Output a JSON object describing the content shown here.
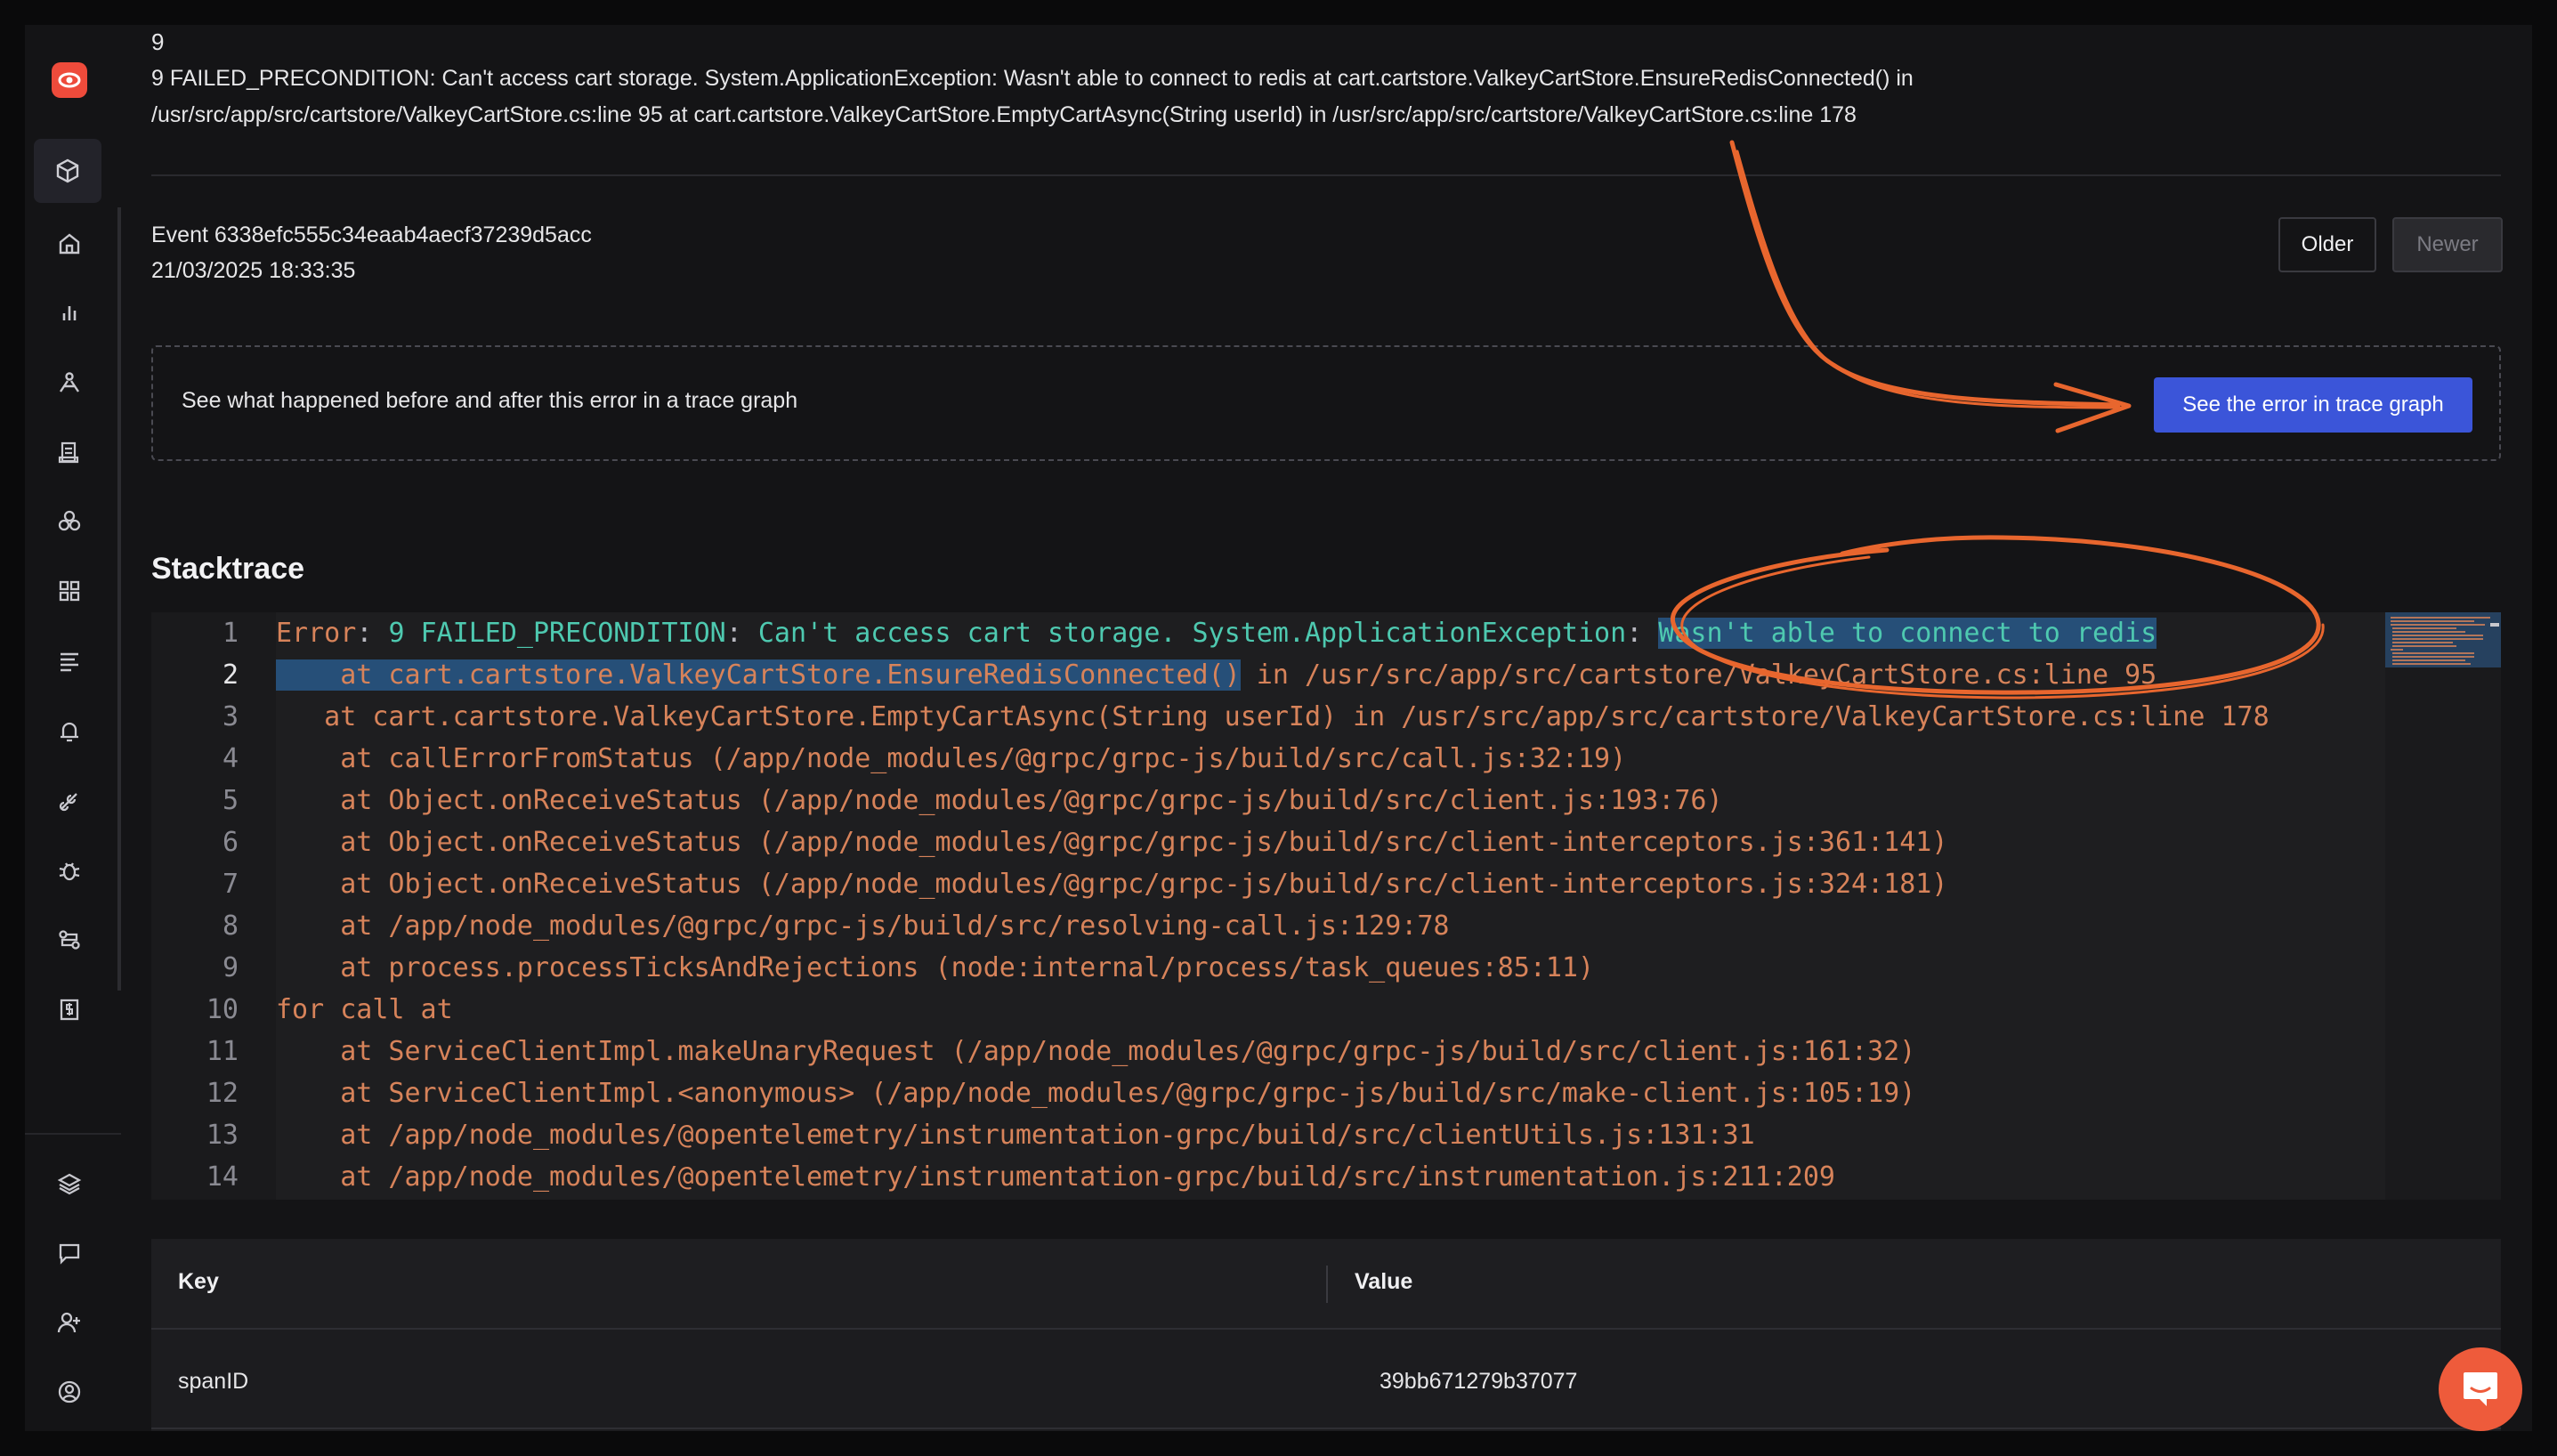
{
  "header": {
    "count": "9",
    "message_line1": "9 FAILED_PRECONDITION: Can't access cart storage. System.ApplicationException: Wasn't able to connect to redis at cart.cartstore.ValkeyCartStore.EnsureRedisConnected() in",
    "message_line2": "/usr/src/app/src/cartstore/ValkeyCartStore.cs:line 95 at cart.cartstore.ValkeyCartStore.EmptyCartAsync(String userId) in /usr/src/app/src/cartstore/ValkeyCartStore.cs:line 178"
  },
  "event": {
    "id": "Event 6338efc555c34eaab4aecf37239d5acc",
    "time": "21/03/2025 18:33:35",
    "older_label": "Older",
    "newer_label": "Newer"
  },
  "trace": {
    "text": "See what happened before and after this error in a trace graph",
    "button_label": "See the error in trace graph"
  },
  "stacktrace": {
    "title": "Stacktrace",
    "lines": [
      {
        "num": "1",
        "parts": [
          [
            "c-red",
            "Error"
          ],
          [
            "c-gray",
            ": "
          ],
          [
            "c-teal",
            "9 FAILED_PRECONDITION"
          ],
          [
            "c-gray",
            ": "
          ],
          [
            "c-teal",
            "Can't access cart storage. System.ApplicationException"
          ],
          [
            "c-gray",
            ": "
          ],
          [
            "c-teal hl",
            "Wasn't able to connect to redis"
          ]
        ]
      },
      {
        "num": "2",
        "parts": [
          [
            "c-red hl2",
            "    at cart.cartstore.ValkeyCartStore.EnsureRedisConnected()"
          ],
          [
            "c-red",
            " in /usr/src/app/src/cartstore/ValkeyCartStore.cs:line 95"
          ]
        ]
      },
      {
        "num": "3",
        "parts": [
          [
            "c-red",
            "   at cart.cartstore.ValkeyCartStore.EmptyCartAsync(String userId) in /usr/src/app/src/cartstore/ValkeyCartStore.cs:line 178"
          ]
        ]
      },
      {
        "num": "4",
        "parts": [
          [
            "c-red",
            "    at callErrorFromStatus (/app/node_modules/@grpc/grpc-js/build/src/call.js:32:19)"
          ]
        ]
      },
      {
        "num": "5",
        "parts": [
          [
            "c-red",
            "    at Object.onReceiveStatus (/app/node_modules/@grpc/grpc-js/build/src/client.js:193:76)"
          ]
        ]
      },
      {
        "num": "6",
        "parts": [
          [
            "c-red",
            "    at Object.onReceiveStatus (/app/node_modules/@grpc/grpc-js/build/src/client-interceptors.js:361:141)"
          ]
        ]
      },
      {
        "num": "7",
        "parts": [
          [
            "c-red",
            "    at Object.onReceiveStatus (/app/node_modules/@grpc/grpc-js/build/src/client-interceptors.js:324:181)"
          ]
        ]
      },
      {
        "num": "8",
        "parts": [
          [
            "c-red",
            "    at /app/node_modules/@grpc/grpc-js/build/src/resolving-call.js:129:78"
          ]
        ]
      },
      {
        "num": "9",
        "parts": [
          [
            "c-red",
            "    at process.processTicksAndRejections (node:internal/process/task_queues:85:11)"
          ]
        ]
      },
      {
        "num": "10",
        "parts": [
          [
            "c-red",
            "for call at"
          ]
        ]
      },
      {
        "num": "11",
        "parts": [
          [
            "c-red",
            "    at ServiceClientImpl.makeUnaryRequest (/app/node_modules/@grpc/grpc-js/build/src/client.js:161:32)"
          ]
        ]
      },
      {
        "num": "12",
        "parts": [
          [
            "c-red",
            "    at ServiceClientImpl.<anonymous> (/app/node_modules/@grpc/grpc-js/build/src/make-client.js:105:19)"
          ]
        ]
      },
      {
        "num": "13",
        "parts": [
          [
            "c-red",
            "    at /app/node_modules/@opentelemetry/instrumentation-grpc/build/src/clientUtils.js:131:31"
          ]
        ]
      },
      {
        "num": "14",
        "parts": [
          [
            "c-red",
            "    at /app/node_modules/@opentelemetry/instrumentation-grpc/build/src/instrumentation.js:211:209"
          ]
        ]
      }
    ]
  },
  "table": {
    "key_header": "Key",
    "value_header": "Value",
    "rows": [
      {
        "key": "spanID",
        "value": "39bb671279b37077"
      }
    ]
  },
  "sidebar": {
    "icons": [
      "logo-icon",
      "cube-icon",
      "home-icon",
      "bar-chart-icon",
      "route-icon",
      "logs-icon",
      "nodes-icon",
      "grid-icon",
      "list-icon",
      "alert-icon",
      "pipeline-icon",
      "bug-icon",
      "flow-icon",
      "billing-icon",
      "layers-icon",
      "chat-icon",
      "add-user-icon",
      "account-icon"
    ]
  },
  "colors": {
    "accent": "#3b55d9",
    "annotation": "#e8662e",
    "error_text": "#d7835a",
    "teal_text": "#4ec9b0",
    "selection": "#264f78"
  }
}
